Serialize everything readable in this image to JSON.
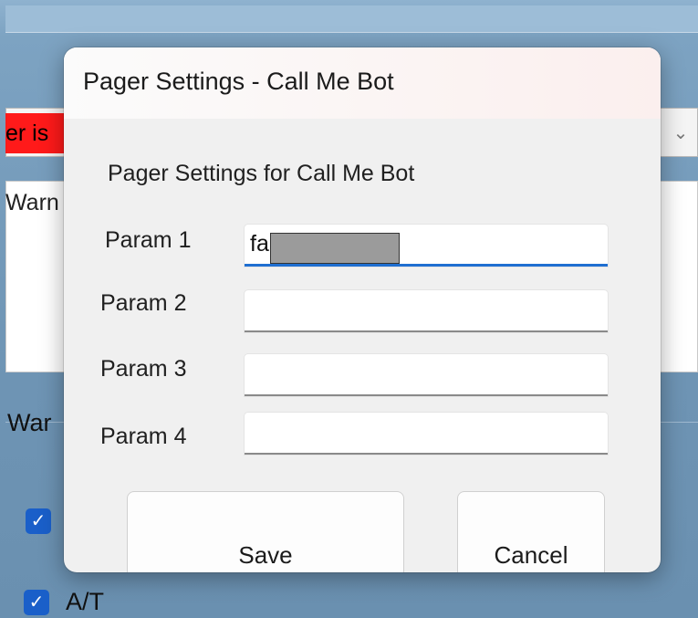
{
  "background": {
    "alert_text": "er is",
    "warning_text_1": "Warn",
    "warning_text_2": "War",
    "checkbox_label": "A/T",
    "check_glyph": "✓",
    "chevron_glyph": "⌄",
    "alert_color": "#ff1a1a",
    "checkbox_color": "#1a5fc9"
  },
  "dialog": {
    "title": "Pager Settings - Call Me Bot",
    "heading": "Pager Settings for Call Me Bot",
    "params": [
      {
        "label": "Param 1",
        "value": "fa",
        "placeholder": ""
      },
      {
        "label": "Param 2",
        "value": "",
        "placeholder": ""
      },
      {
        "label": "Param 3",
        "value": "",
        "placeholder": ""
      },
      {
        "label": "Param 4",
        "value": "",
        "placeholder": ""
      }
    ],
    "save_label": "Save",
    "cancel_label": "Cancel",
    "focus_color": "#1f6fd1"
  }
}
